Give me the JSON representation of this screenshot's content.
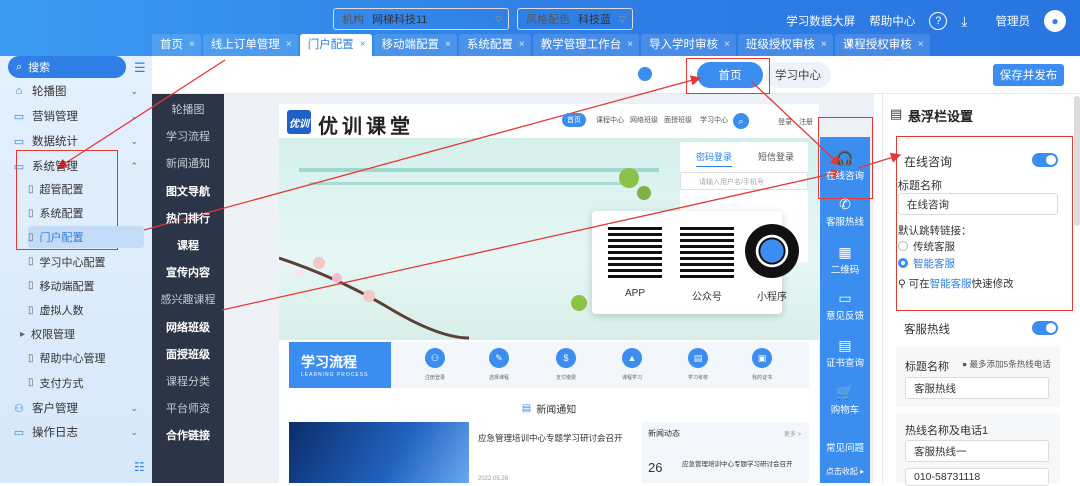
{
  "header": {
    "tabs": [
      {
        "label": "首页"
      },
      {
        "label": "线上订单管理"
      },
      {
        "label": "门户配置"
      },
      {
        "label": "移动端配置"
      },
      {
        "label": "系统配置"
      },
      {
        "label": "教学管理工作台"
      },
      {
        "label": "导入学时审核"
      },
      {
        "label": "班级授权审核"
      },
      {
        "label": "课程授权审核"
      }
    ],
    "active_tab": "门户配置",
    "close_glyph": "×",
    "more_glyph": "∨",
    "study_link": "学习数据大屏",
    "help": "帮助中心",
    "user": "管理员"
  },
  "sidebar": {
    "search_placeholder": "搜索",
    "items": [
      {
        "label": "轮播图",
        "icon": "home-icon"
      },
      {
        "label": "营销管理",
        "icon": "folder-icon"
      },
      {
        "label": "数据统计",
        "icon": "folder-icon"
      },
      {
        "label": "系统管理",
        "icon": "folder-icon"
      }
    ],
    "sub_items": [
      {
        "label": "超管配置"
      },
      {
        "label": "系统配置"
      },
      {
        "label": "门户配置"
      },
      {
        "label": "学习中心配置"
      },
      {
        "label": "移动端配置"
      },
      {
        "label": "虚拟人数"
      },
      {
        "label": "权限管理"
      },
      {
        "label": "帮助中心管理"
      },
      {
        "label": "支付方式"
      }
    ],
    "bottom_items": [
      {
        "label": "客户管理"
      },
      {
        "label": "操作日志"
      }
    ]
  },
  "toolbar": {
    "org_label": "机构",
    "org_value": "网梯科技11",
    "style_label": "风格配色",
    "style_value": "科技蓝",
    "style_color": "#3b8df0",
    "home_pill": "首页",
    "study_pill": "学习中心",
    "save_button": "保存并发布"
  },
  "modules": [
    "轮播图",
    "学习流程",
    "新闻通知",
    "图文导航",
    "热门排行",
    "课程",
    "宣传内容",
    "感兴趣课程",
    "网络班级",
    "面授班级",
    "课程分类",
    "平台师资",
    "合作链接"
  ],
  "preview": {
    "logo_mark": "优训",
    "logo_text": "优训课堂",
    "nav": [
      "首页",
      "课程中心",
      "网络班级",
      "面授班级",
      "学习中心"
    ],
    "login_nav": "登录",
    "register_nav": "注册",
    "login_tabs": [
      "密码登录",
      "短信登录"
    ],
    "login_placeholder": "请输入用户名/手机号",
    "qr": [
      {
        "label": "APP"
      },
      {
        "label": "公众号"
      },
      {
        "label": "小程序"
      }
    ],
    "process_title": "学习流程",
    "process_sub": "LEARNING PROCESS",
    "steps": [
      "注册登录",
      "选择课程",
      "支付缴费",
      "课程学习",
      "学习考核",
      "我的证书"
    ],
    "news_title": "新闻通知",
    "news_headline": "应急管理培训中心专题学习研讨会召开",
    "news_dyn": "新闻动态",
    "news_more": "更多 >",
    "news_day": "26",
    "news_date": "2022.05.26",
    "news_item": "应急管理培训中心专题学习研讨会召开"
  },
  "floatbar": [
    {
      "label": "在线咨询",
      "icon": "headset-icon"
    },
    {
      "label": "客服热线",
      "icon": "phone-icon"
    },
    {
      "label": "二维码",
      "icon": "qrcode-icon"
    },
    {
      "label": "意见反馈",
      "icon": "feedback-icon"
    },
    {
      "label": "证书查询",
      "icon": "certificate-icon"
    },
    {
      "label": "购物车",
      "icon": "cart-icon"
    },
    {
      "label": "常见问题",
      "icon": "question-icon"
    }
  ],
  "floatbar_collapse": "点击收起 ▸",
  "panel": {
    "title": "悬浮栏设置",
    "online": {
      "label": "在线咨询",
      "title_label": "标题名称",
      "title_value": "在线咨询",
      "link_label": "默认跳转链接：",
      "opt1": "传统客服",
      "opt2": "智能客服",
      "note_pre": "可在",
      "note_link": "智能客服",
      "note_post": "快速修改"
    },
    "hotline": {
      "label": "客服热线",
      "title_label": "标题名称",
      "hint": "最多添加5条热线电话",
      "title_value": "客服热线",
      "phone_label": "热线名称及电话1",
      "phone_name": "客服热线一",
      "phone_num": "010-58731118"
    }
  }
}
